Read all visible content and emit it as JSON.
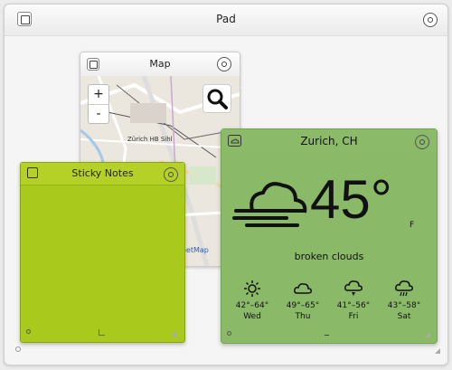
{
  "pad": {
    "title": "Pad"
  },
  "map": {
    "title": "Map",
    "zoom_in": "+",
    "zoom_out": "-",
    "station_label": "Zürich HB Sihl",
    "attribution": "eetMap"
  },
  "sticky": {
    "title": "Sticky Notes"
  },
  "weather": {
    "title": "Zurich, CH",
    "temperature": "45°",
    "unit": "F",
    "condition": "broken clouds",
    "forecast": [
      {
        "range": "42°–64°",
        "day": "Wed",
        "icon": "sun-icon"
      },
      {
        "range": "49°–65°",
        "day": "Thu",
        "icon": "cloud-icon"
      },
      {
        "range": "41°–56°",
        "day": "Fri",
        "icon": "cloud-rain-icon"
      },
      {
        "range": "43°–58°",
        "day": "Sat",
        "icon": "cloud-rain-icon"
      }
    ]
  },
  "colors": {
    "sticky": "#a9c91d",
    "weather": "#8aba68"
  }
}
